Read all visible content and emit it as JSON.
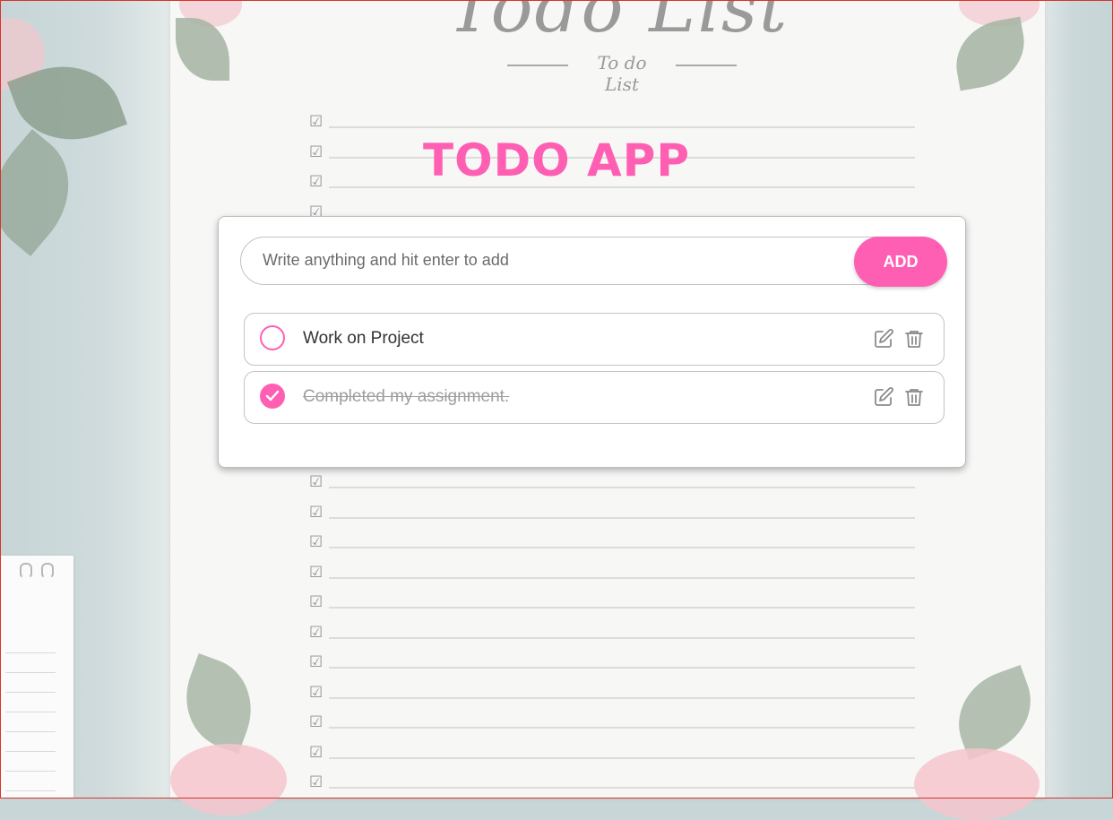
{
  "background": {
    "paper_title": "Todo List",
    "paper_subtitle": "To do List"
  },
  "app": {
    "title": "TODO APP",
    "accent_color": "#ff5fb3"
  },
  "input": {
    "placeholder": "Write anything and hit enter to add",
    "value": ""
  },
  "add_button": {
    "label": "ADD"
  },
  "todos": [
    {
      "text": "Work on Project",
      "completed": false,
      "edit_icon": "edit-icon",
      "delete_icon": "trash-icon"
    },
    {
      "text": "Completed my assignment.",
      "completed": true,
      "edit_icon": "edit-icon",
      "delete_icon": "trash-icon"
    }
  ]
}
